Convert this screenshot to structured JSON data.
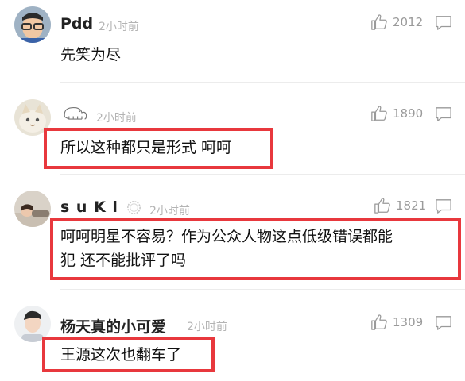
{
  "comments": [
    {
      "username": "Pdd",
      "time": "2小时前",
      "likes": "2012",
      "text": "先笑为尽",
      "highlighted": false,
      "avatar": "person-with-glasses"
    },
    {
      "username": "",
      "username_icon": "elephant-logo",
      "time": "2小时前",
      "likes": "1890",
      "text": "所以这种都只是形式 呵呵",
      "highlighted": true,
      "avatar": "cat"
    },
    {
      "username": "s u K l",
      "username_badge": "lace-badge",
      "time": "2小时前",
      "likes": "1821",
      "text_lines": [
        "呵呵明星不容易？作为公众人物这点低级错误都能",
        "犯 还不能批评了吗"
      ],
      "highlighted": true,
      "avatar": "lying-person"
    },
    {
      "username": "杨天真的小可爱",
      "time": "2小时前",
      "likes": "1309",
      "text": "王源这次也翻车了",
      "highlighted": true,
      "avatar": "young-man"
    }
  ],
  "colors": {
    "highlight": "#e8383d",
    "muted": "#9a9a9a",
    "time": "#b4b4b4"
  }
}
